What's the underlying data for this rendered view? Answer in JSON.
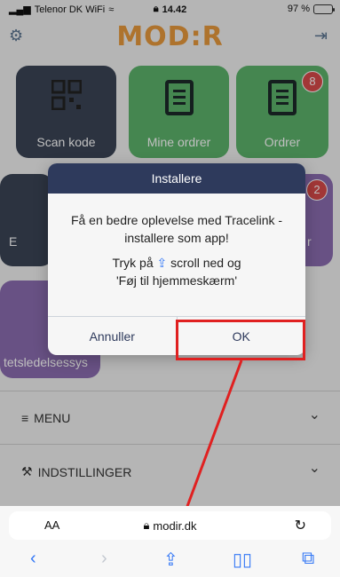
{
  "status_bar": {
    "carrier": "Telenor DK WiFi",
    "time": "14.42",
    "battery": "97 %"
  },
  "header": {
    "logo": "MOD:R",
    "settings_icon": "gear-icon",
    "logout_icon": "logout-icon"
  },
  "tiles": {
    "scan": {
      "label": "Scan kode"
    },
    "mine": {
      "label": "Mine ordrer"
    },
    "orders": {
      "label": "Ordrer",
      "badge": "8"
    },
    "row2_right_badge": "2",
    "row2_left_fragment": "E",
    "row2_right_fragment": "r",
    "purple": {
      "label": "tetsledelsessys"
    }
  },
  "menu": {
    "menu_label": "MENU",
    "settings_label": "INDSTILLINGER"
  },
  "dialog": {
    "title": "Installere",
    "line1": "Få en bedre oplevelse med Tracelink - installere som app!",
    "line2_prefix": "Tryk på",
    "line2_suffix": "scroll ned og",
    "line3": "'Føj til hjemmeskærm'",
    "cancel": "Annuller",
    "ok": "OK"
  },
  "browser": {
    "aa": "AA",
    "domain": "modir.dk"
  },
  "colors": {
    "tile_dark": "#3b4556",
    "tile_green": "#5cb36b",
    "dialog_header": "#2e3a5c",
    "annotation_red": "#e02020",
    "ios_blue": "#3478f6"
  }
}
